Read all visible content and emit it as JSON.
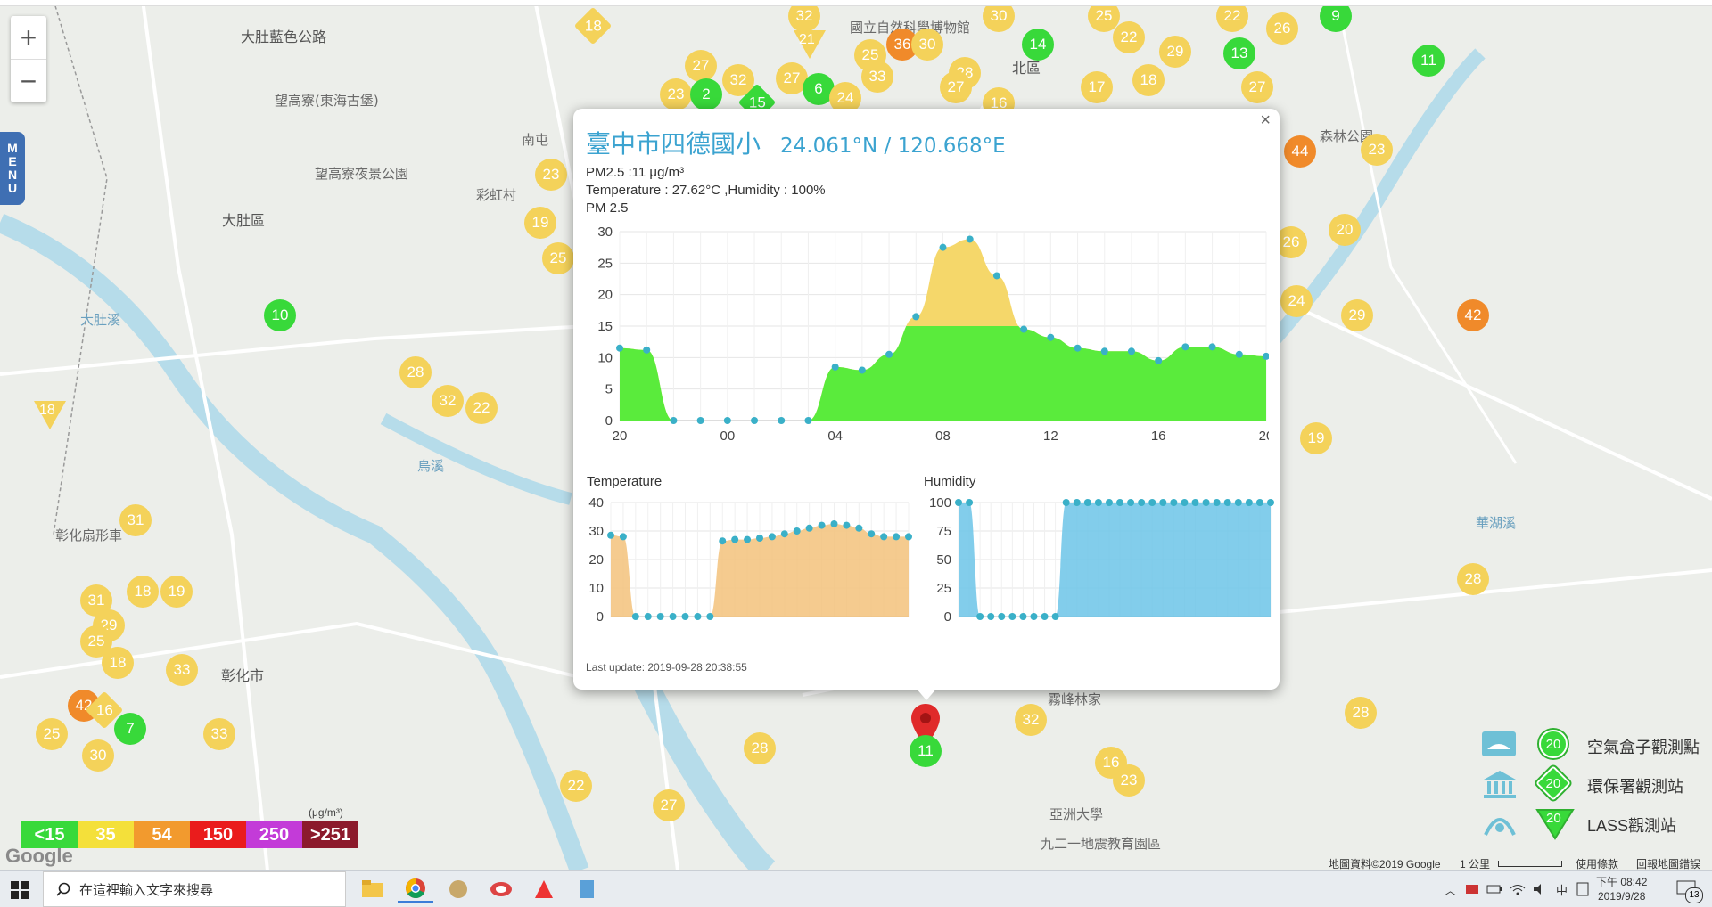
{
  "map": {
    "zoom_in": "+",
    "zoom_out": "−",
    "menu": [
      "M",
      "E",
      "N",
      "U"
    ],
    "labels": [
      {
        "text": "大肚藍色公路"
      },
      {
        "text": "望高寮(東海古堡)"
      },
      {
        "text": "望高寮夜景公園"
      },
      {
        "text": "大肚區"
      },
      {
        "text": "彰化市"
      },
      {
        "text": "彰化扇形車"
      },
      {
        "text": "北區"
      },
      {
        "text": "國立自然科學博物館"
      },
      {
        "text": "森林公園"
      },
      {
        "text": "亞洲大學"
      },
      {
        "text": "九二一地震教育園區"
      },
      {
        "text": "霧峰林家"
      },
      {
        "text": "大肚溪"
      },
      {
        "text": "烏溪"
      },
      {
        "text": "南屯"
      },
      {
        "text": "彩虹村"
      },
      {
        "text": "華湖溪"
      }
    ],
    "markers": [
      {
        "v": "18",
        "c": "y",
        "s": "dia"
      },
      {
        "v": "32",
        "c": "y"
      },
      {
        "v": "30",
        "c": "y"
      },
      {
        "v": "25",
        "c": "y"
      },
      {
        "v": "22",
        "c": "y"
      },
      {
        "v": "9",
        "c": "g"
      },
      {
        "v": "26",
        "c": "y"
      },
      {
        "v": "11",
        "c": "g"
      },
      {
        "v": "27",
        "c": "y"
      },
      {
        "v": "21",
        "c": "y",
        "s": "tri"
      },
      {
        "v": "25",
        "c": "y"
      },
      {
        "v": "36",
        "c": "o"
      },
      {
        "v": "30",
        "c": "y"
      },
      {
        "v": "28",
        "c": "y"
      },
      {
        "v": "14",
        "c": "g"
      },
      {
        "v": "22",
        "c": "y"
      },
      {
        "v": "29",
        "c": "y"
      },
      {
        "v": "13",
        "c": "g"
      },
      {
        "v": "27",
        "c": "y"
      },
      {
        "v": "23",
        "c": "y"
      },
      {
        "v": "2",
        "c": "g"
      },
      {
        "v": "32",
        "c": "y"
      },
      {
        "v": "27",
        "c": "y"
      },
      {
        "v": "6",
        "c": "g"
      },
      {
        "v": "33",
        "c": "y"
      },
      {
        "v": "27",
        "c": "y"
      },
      {
        "v": "17",
        "c": "y"
      },
      {
        "v": "18",
        "c": "y"
      },
      {
        "v": "15",
        "c": "g",
        "s": "dia"
      },
      {
        "v": "24",
        "c": "y"
      },
      {
        "v": "16",
        "c": "y"
      },
      {
        "v": "44",
        "c": "o"
      },
      {
        "v": "23",
        "c": "y"
      },
      {
        "v": "23",
        "c": "y"
      },
      {
        "v": "19",
        "c": "y"
      },
      {
        "v": "25",
        "c": "y"
      },
      {
        "v": "10",
        "c": "g"
      },
      {
        "v": "28",
        "c": "y"
      },
      {
        "v": "32",
        "c": "y"
      },
      {
        "v": "22",
        "c": "y"
      },
      {
        "v": "18",
        "c": "y",
        "s": "tri"
      },
      {
        "v": "26",
        "c": "y"
      },
      {
        "v": "20",
        "c": "y"
      },
      {
        "v": "24",
        "c": "y"
      },
      {
        "v": "29",
        "c": "y"
      },
      {
        "v": "42",
        "c": "o"
      },
      {
        "v": "19",
        "c": "y"
      },
      {
        "v": "31",
        "c": "y"
      },
      {
        "v": "31",
        "c": "y"
      },
      {
        "v": "18",
        "c": "y"
      },
      {
        "v": "19",
        "c": "y"
      },
      {
        "v": "29",
        "c": "y"
      },
      {
        "v": "25",
        "c": "y"
      },
      {
        "v": "18",
        "c": "y"
      },
      {
        "v": "33",
        "c": "y"
      },
      {
        "v": "42",
        "c": "o"
      },
      {
        "v": "16",
        "c": "y",
        "s": "dia"
      },
      {
        "v": "7",
        "c": "g"
      },
      {
        "v": "25",
        "c": "y"
      },
      {
        "v": "30",
        "c": "y"
      },
      {
        "v": "33",
        "c": "y"
      },
      {
        "v": "28",
        "c": "y"
      },
      {
        "v": "22",
        "c": "y"
      },
      {
        "v": "27",
        "c": "y"
      },
      {
        "v": "32",
        "c": "y"
      },
      {
        "v": "16",
        "c": "y"
      },
      {
        "v": "23",
        "c": "y"
      },
      {
        "v": "28",
        "c": "y"
      },
      {
        "v": "28",
        "c": "y"
      },
      {
        "v": "11",
        "c": "g"
      }
    ]
  },
  "popup": {
    "title": "臺中市四德國小",
    "coords": "24.061°N / 120.668°E",
    "pm25_line": "PM2.5 :11 μg/m³",
    "temp_line": "Temperature : 27.62°C ,Humidity : 100%",
    "pm_label": "PM 2.5",
    "temp_label": "Temperature",
    "hum_label": "Humidity",
    "last_update": "Last update: 2019-09-28 20:38:55",
    "close": "×"
  },
  "chart_data": [
    {
      "type": "area",
      "title": "PM 2.5",
      "xticks": [
        "20",
        "00",
        "04",
        "08",
        "12",
        "16",
        "20"
      ],
      "yticks": [
        0,
        5,
        10,
        15,
        20,
        25,
        30
      ],
      "ylim": [
        0,
        30
      ],
      "threshold": 15,
      "colors": {
        "low": "#5aeb3c",
        "high": "#f5d76a",
        "point": "#3ab0c8"
      },
      "x": [
        0,
        1,
        2,
        3,
        4,
        5,
        6,
        7,
        8,
        9,
        10,
        11,
        12,
        13,
        14,
        15,
        16,
        17,
        18,
        19,
        20,
        21,
        22,
        23,
        24
      ],
      "values": [
        11.5,
        11.2,
        0,
        0,
        0,
        0,
        0,
        0,
        8.5,
        8,
        10.5,
        16.5,
        27.5,
        28.8,
        23,
        14.5,
        13.2,
        11.5,
        11,
        11,
        9.5,
        11.7,
        11.7,
        10.5,
        10.2
      ]
    },
    {
      "type": "area",
      "title": "Temperature",
      "yticks": [
        0,
        10,
        20,
        30,
        40
      ],
      "ylim": [
        0,
        40
      ],
      "color": "#f3c27b",
      "values": [
        28.5,
        28,
        0,
        0,
        0,
        0,
        0,
        0,
        0,
        26.5,
        27,
        27,
        27.5,
        28,
        29,
        30,
        31,
        32,
        32.5,
        32,
        31,
        29,
        28,
        28,
        28
      ]
    },
    {
      "type": "area",
      "title": "Humidity",
      "yticks": [
        0,
        25,
        50,
        75,
        100
      ],
      "ylim": [
        0,
        100
      ],
      "color": "#6cc4e8",
      "values": [
        100,
        100,
        0,
        0,
        0,
        0,
        0,
        0,
        0,
        0,
        100,
        100,
        100,
        100,
        100,
        100,
        100,
        100,
        100,
        100,
        100,
        100,
        100,
        100,
        100,
        100,
        100,
        100,
        100,
        100
      ]
    }
  ],
  "legend": {
    "unit": "(μg/m³)",
    "items": [
      {
        "label": "<15",
        "color": "#38d93a"
      },
      {
        "label": "35",
        "color": "#f4e03a"
      },
      {
        "label": "54",
        "color": "#f29a2e"
      },
      {
        "label": "150",
        "color": "#ea1c1c"
      },
      {
        "label": "250",
        "color": "#c33bd8"
      },
      {
        "label": ">251",
        "color": "#8c1a2c"
      }
    ]
  },
  "station_legend": [
    {
      "label": "空氣盒子觀測點",
      "value": "20"
    },
    {
      "label": "環保署觀測站",
      "value": "20"
    },
    {
      "label": "LASS觀測站",
      "value": "20"
    }
  ],
  "attribution": {
    "data": "地圖資料©2019 Google",
    "scale": "1 公里",
    "terms": "使用條款",
    "report": "回報地圖錯誤",
    "google": "Google"
  },
  "taskbar": {
    "search_placeholder": "在這裡輸入文字來搜尋",
    "ime": "中",
    "time": "下午 08:42",
    "date": "2019/9/28",
    "notif": "13"
  }
}
